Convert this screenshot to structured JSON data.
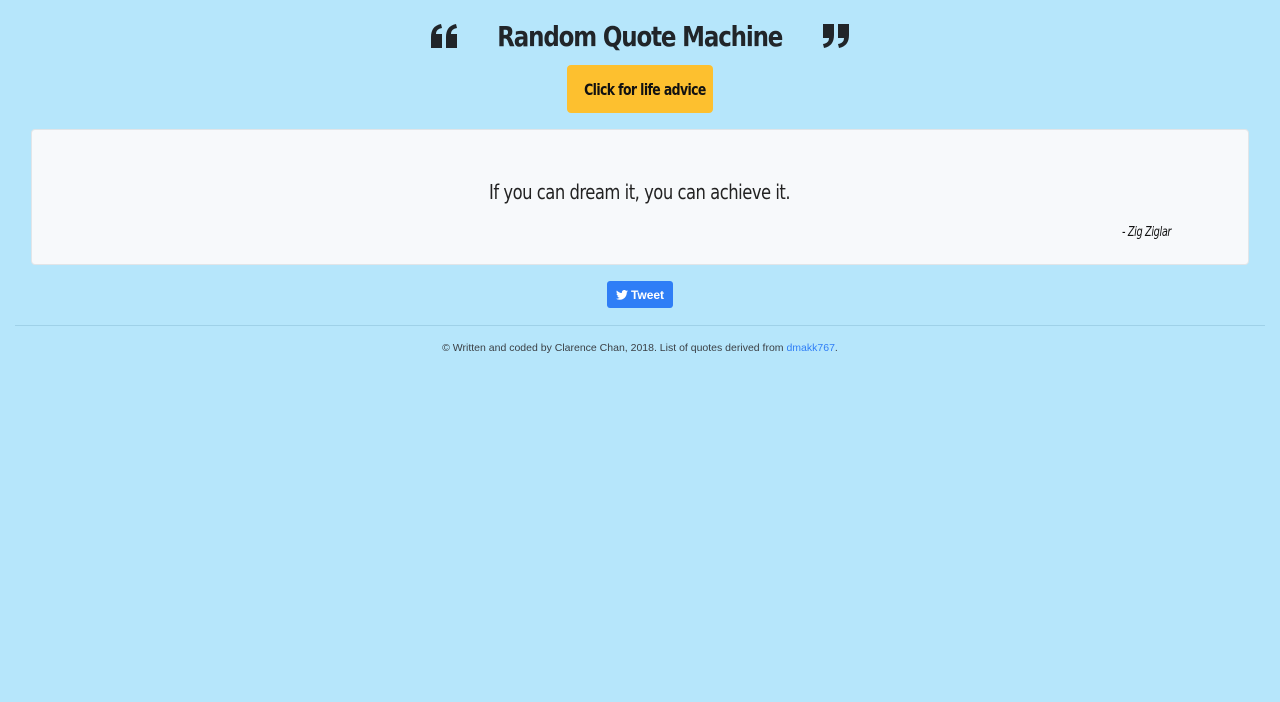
{
  "header": {
    "title": "Random Quote Machine",
    "left_icon": "quote-left-icon",
    "right_icon": "quote-right-icon"
  },
  "advice_button": {
    "label": "Click for life advice"
  },
  "quote": {
    "text": "If you can dream it, you can achieve it.",
    "author": "- Zig Ziglar"
  },
  "tweet_button": {
    "label": "Tweet",
    "icon": "twitter-icon"
  },
  "footer": {
    "text_before": "© Written and coded by Clarence Chan, 2018. List of quotes derived from ",
    "link_text": "dmakk767",
    "text_after": "."
  },
  "colors": {
    "background": "#b6e6fb",
    "advice_button": "#fdc02f",
    "tweet_button": "#2f7ef6",
    "card": "#f7f9fb",
    "link": "#2f7ef6"
  }
}
